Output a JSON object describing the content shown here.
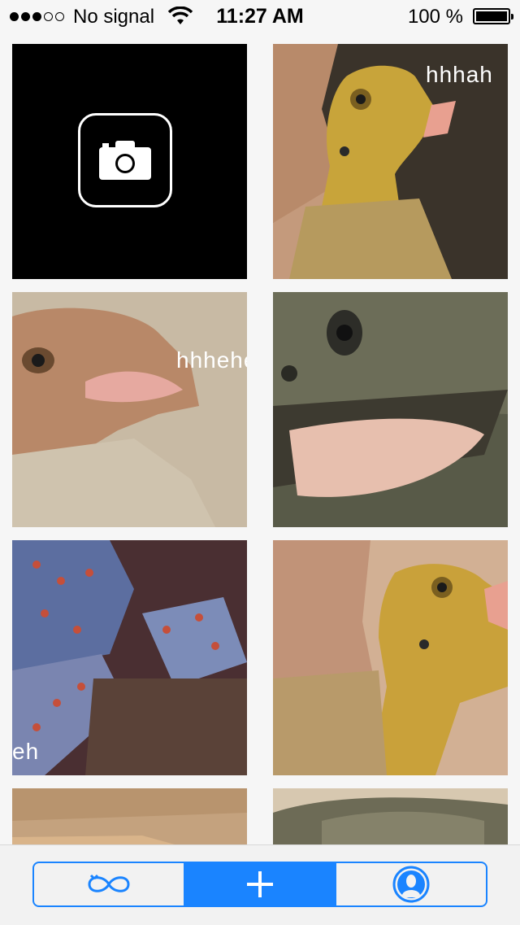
{
  "status_bar": {
    "signal_bars_filled": 3,
    "signal_bars_total": 5,
    "carrier": "No signal",
    "time": "11:27 AM",
    "battery_percent": "100 %",
    "battery_level": 1.0
  },
  "grid": {
    "camera_tile": {
      "icon": "camera-icon"
    },
    "captions": {
      "tile_2": "hhhah",
      "tile_3": "hhhehe",
      "tile_5": "eh"
    }
  },
  "tab_bar": {
    "segments": [
      {
        "icon": "loop-icon",
        "selected": false
      },
      {
        "icon": "plus-icon",
        "selected": true
      },
      {
        "icon": "profile-icon",
        "selected": false
      }
    ],
    "accent_color": "#1a84ff"
  }
}
